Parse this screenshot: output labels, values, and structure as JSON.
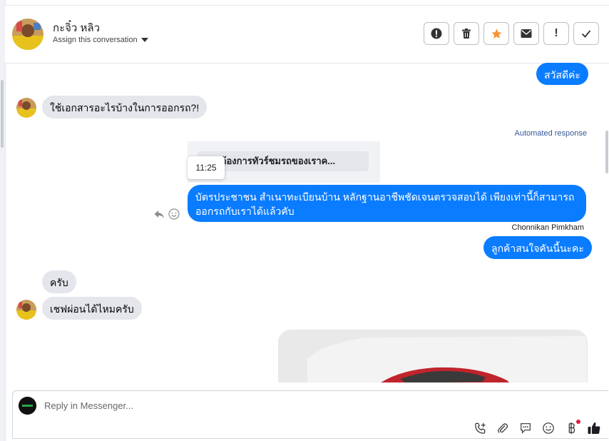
{
  "header": {
    "contact_name": "กะจิ๋ว หลิว",
    "assign_label": "Assign this conversation",
    "actions": [
      {
        "name": "spam-button",
        "icon": "alert-circle-icon"
      },
      {
        "name": "delete-button",
        "icon": "trash-icon"
      },
      {
        "name": "star-button",
        "icon": "star-icon"
      },
      {
        "name": "mark-unread-button",
        "icon": "envelope-icon"
      },
      {
        "name": "follow-up-button",
        "label": "!"
      },
      {
        "name": "done-button",
        "icon": "check-icon"
      }
    ]
  },
  "messages": {
    "greeting_out": "สวัสดีค่ะ",
    "question_in": "ใช้เอกสารอะไรบ้างในการออกรถ?!",
    "automated_label": "Automated response",
    "quoted_text": "ต้องการทัวร์ชมรถของเราค...",
    "tooltip_time": "11:25",
    "docs_out": "บัตรประชาชน สำเนาทะเบียนบ้าน หลักฐานอาชีพชัดเจนตรวจสอบได้ เพียงเท่านี้ก็สามารถออกรถกับเราได้แล้วคับ",
    "agent_name": "Chonnikan Pimkham",
    "interest_out": "ลูกค้าสนใจคันนี้นะคะ",
    "reply_in_1": "ครับ",
    "reply_in_2": "เชฟผ่อนได้ไหมครับ"
  },
  "composer": {
    "placeholder": "Reply in Messenger...",
    "tools": [
      "phone-plus-icon",
      "paperclip-icon",
      "chat-icon",
      "emoji-icon",
      "baht-icon",
      "thumbs-up-icon"
    ]
  },
  "colors": {
    "outgoing": "#0a7cff",
    "incoming": "#e4e6eb",
    "star": "#f7923a",
    "notification_dot": "#e41e3f"
  }
}
